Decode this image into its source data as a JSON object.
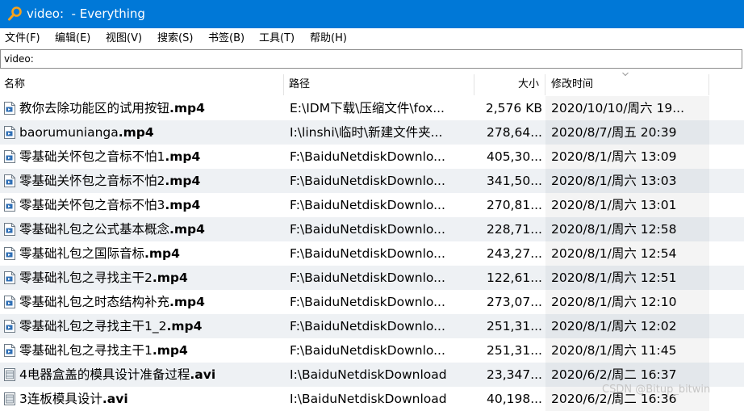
{
  "window": {
    "title": "video:  - Everything"
  },
  "menu": [
    {
      "label": "文件(F)"
    },
    {
      "label": "编辑(E)"
    },
    {
      "label": "视图(V)"
    },
    {
      "label": "搜索(S)"
    },
    {
      "label": "书签(B)"
    },
    {
      "label": "工具(T)"
    },
    {
      "label": "帮助(H)"
    }
  ],
  "search": {
    "value": "video:"
  },
  "columns": {
    "name": "名称",
    "path": "路径",
    "size": "大小",
    "modified": "修改时间"
  },
  "rows": [
    {
      "base": "教你去除功能区的试用按钮",
      "ext": ".mp4",
      "path": "E:\\IDM下载\\压缩文件\\fox...",
      "size": "2,576 KB",
      "modified": "2020/10/10/周六 19...",
      "icon": "video-file-icon"
    },
    {
      "base": "baorumuniangа",
      "ext": ".mp4",
      "path": "I:\\linshi\\临时\\新建文件夹...",
      "size": "278,64...",
      "modified": "2020/8/7/周五 20:39",
      "icon": "video-file-icon"
    },
    {
      "base": "零基础关怀包之音标不怕1",
      "ext": ".mp4",
      "path": "F:\\BaiduNetdiskDownlo...",
      "size": "405,30...",
      "modified": "2020/8/1/周六 13:09",
      "icon": "video-file-icon"
    },
    {
      "base": "零基础关怀包之音标不怕2",
      "ext": ".mp4",
      "path": "F:\\BaiduNetdiskDownlo...",
      "size": "341,50...",
      "modified": "2020/8/1/周六 13:03",
      "icon": "video-file-icon"
    },
    {
      "base": "零基础关怀包之音标不怕3",
      "ext": ".mp4",
      "path": "F:\\BaiduNetdiskDownlo...",
      "size": "270,81...",
      "modified": "2020/8/1/周六 13:01",
      "icon": "video-file-icon"
    },
    {
      "base": "零基础礼包之公式基本概念",
      "ext": ".mp4",
      "path": "F:\\BaiduNetdiskDownlo...",
      "size": "228,71...",
      "modified": "2020/8/1/周六 12:58",
      "icon": "video-file-icon"
    },
    {
      "base": "零基础礼包之国际音标",
      "ext": ".mp4",
      "path": "F:\\BaiduNetdiskDownlo...",
      "size": "243,27...",
      "modified": "2020/8/1/周六 12:54",
      "icon": "video-file-icon"
    },
    {
      "base": "零基础礼包之寻找主干2",
      "ext": ".mp4",
      "path": "F:\\BaiduNetdiskDownlo...",
      "size": "122,61...",
      "modified": "2020/8/1/周六 12:51",
      "icon": "video-file-icon"
    },
    {
      "base": "零基础礼包之时态结构补充",
      "ext": ".mp4",
      "path": "F:\\BaiduNetdiskDownlo...",
      "size": "273,07...",
      "modified": "2020/8/1/周六 12:10",
      "icon": "video-file-icon"
    },
    {
      "base": "零基础礼包之寻找主干1_2",
      "ext": ".mp4",
      "path": "F:\\BaiduNetdiskDownlo...",
      "size": "251,31...",
      "modified": "2020/8/1/周六 12:02",
      "icon": "video-file-icon"
    },
    {
      "base": "零基础礼包之寻找主干1",
      "ext": ".mp4",
      "path": "F:\\BaiduNetdiskDownlo...",
      "size": "251,31...",
      "modified": "2020/8/1/周六 11:45",
      "icon": "video-file-icon"
    },
    {
      "base": "4电器盒盖的模具设计准备过程",
      "ext": ".avi",
      "path": "I:\\BaiduNetdiskDownload",
      "size": "23,347...",
      "modified": "2020/6/2/周二 16:37",
      "icon": "avi-file-icon"
    },
    {
      "base": "3连板模具设计",
      "ext": ".avi",
      "path": "I:\\BaiduNetdiskDownload",
      "size": "40,198...",
      "modified": "2020/6/2/周二 16:36",
      "icon": "avi-file-icon"
    }
  ],
  "watermark": "CSDN @Bitup_bitwin",
  "colors": {
    "titlebar": "#0078d7",
    "alt_row": "#eef1f4"
  }
}
